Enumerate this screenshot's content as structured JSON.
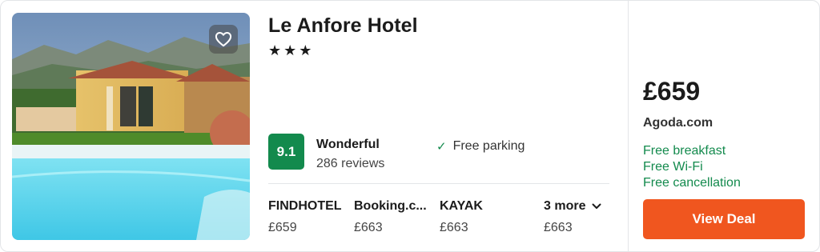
{
  "hotel": {
    "name": "Le Anfore Hotel",
    "stars_text": "★★★",
    "score": "9.1",
    "rating_word": "Wonderful",
    "reviews": "286 reviews",
    "amenity": "Free parking",
    "amenity_icon": "check-icon",
    "favorite_icon": "heart-outline-icon"
  },
  "providers": [
    {
      "name": "FINDHOTEL",
      "price": "£659"
    },
    {
      "name": "Booking.c...",
      "price": "£663"
    },
    {
      "name": "KAYAK",
      "price": "£663"
    }
  ],
  "more": {
    "label": "3 more",
    "price": "£663",
    "icon": "chevron-down-icon"
  },
  "deal": {
    "price": "£659",
    "provider": "Agoda.com",
    "perks": [
      "Free breakfast",
      "Free Wi-Fi",
      "Free cancellation"
    ],
    "button_label": "View Deal"
  },
  "colors": {
    "score_badge": "#138a4d",
    "perk_text": "#138a4d",
    "deal_button": "#f0561f"
  }
}
